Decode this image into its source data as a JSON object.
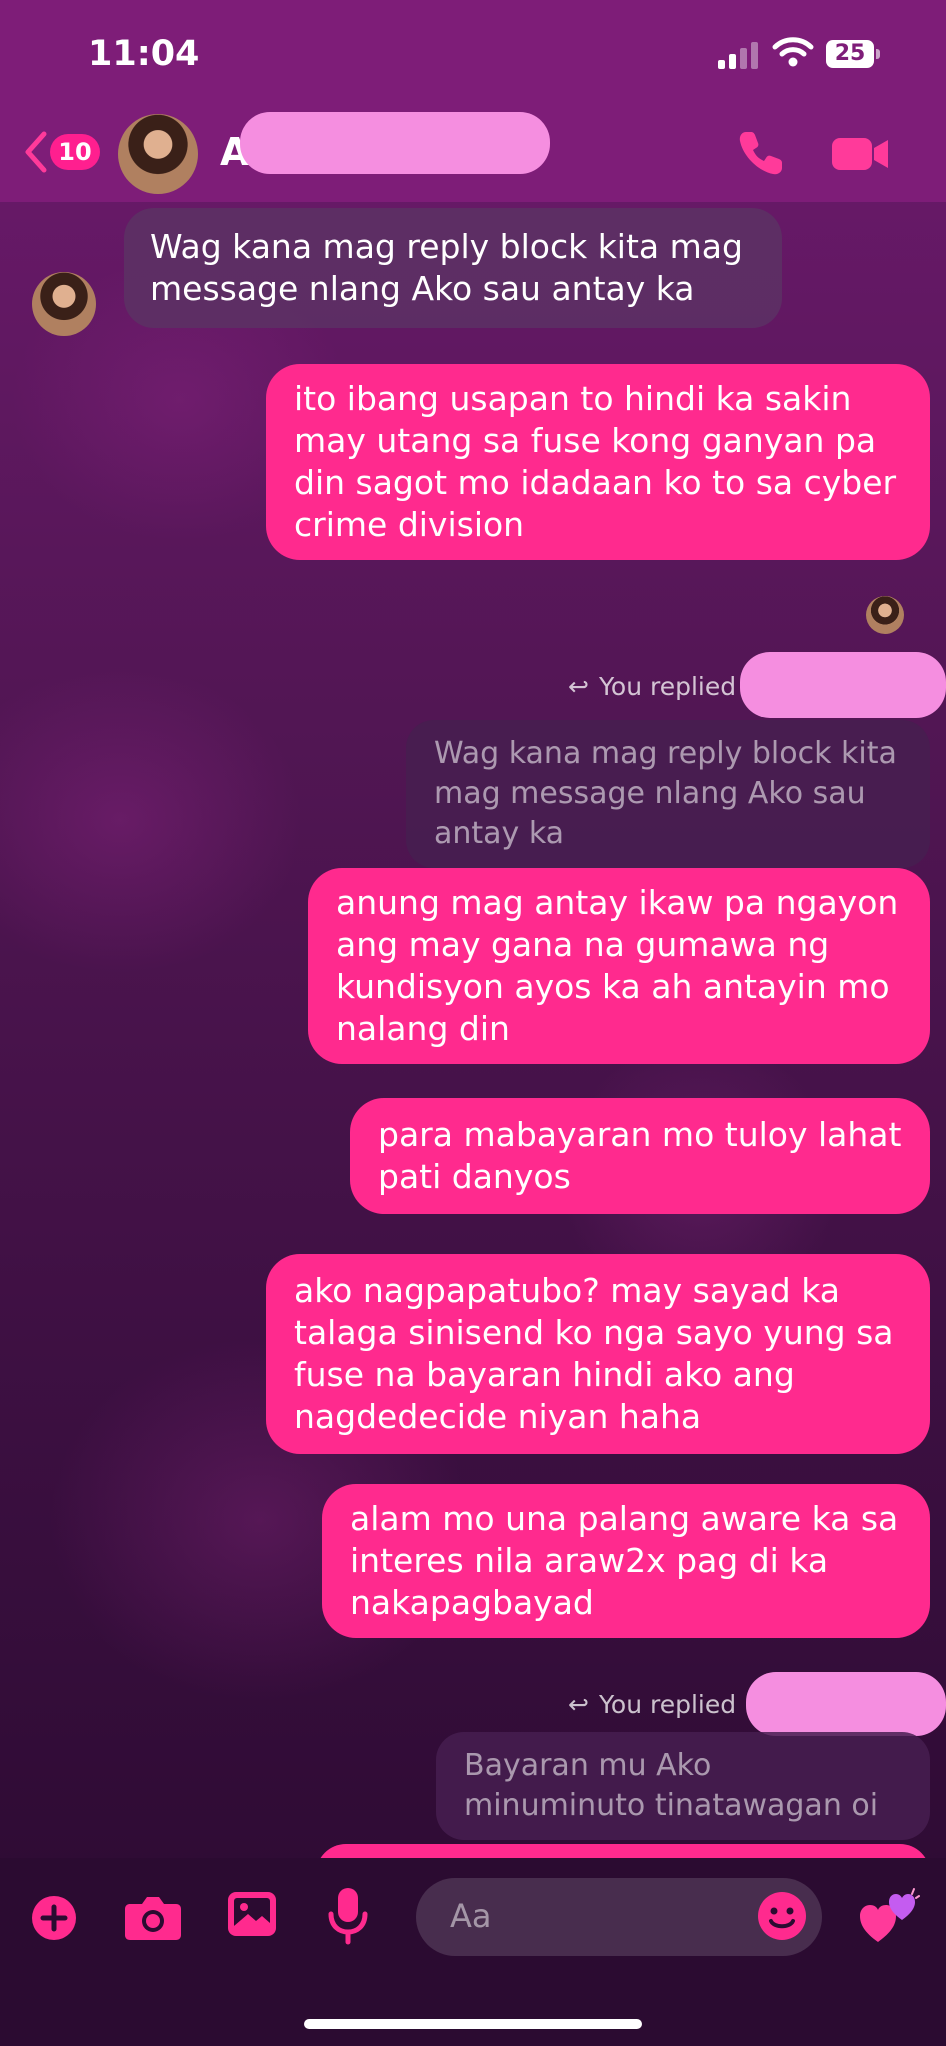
{
  "status_bar": {
    "time": "11:04",
    "battery": "25"
  },
  "header": {
    "back_count": "10",
    "contact_initial": "A"
  },
  "messages": {
    "m1": "Wag kana mag reply block kita mag message nlang Ako sau antay ka",
    "m2": "ito ibang usapan to hindi ka sakin may utang sa fuse kong ganyan pa din sagot mo idadaan ko to sa cyber crime division",
    "reply1_label": "You replied",
    "quote1": "Wag kana mag reply block kita mag message nlang Ako sau antay ka",
    "m3": "anung mag antay ikaw pa ngayon ang may gana na gumawa ng kundisyon ayos ka ah antayin mo nalang din",
    "m4": "para mabayaran mo tuloy lahat pati danyos",
    "m5": "ako nagpapatubo? may sayad ka talaga sinisend ko nga sayo yung sa fuse na bayaran hindi ako ang nagdedecide niyan haha",
    "m6": "alam mo una palang aware ka sa interes nila araw2x pag di ka nakapagbayad",
    "reply2_label": "You replied",
    "quote2": "Bayaran mu Ako minuminuto tinatawagan oi"
  },
  "composer": {
    "placeholder": "Aa"
  },
  "colors": {
    "accent": "#ff2a8e",
    "header": "#7e1d78",
    "incoming": "#5c3064"
  },
  "icons": [
    "back-chevron-icon",
    "phone-icon",
    "video-camera-icon",
    "plus-icon",
    "camera-icon",
    "photo-icon",
    "microphone-icon",
    "emoji-icon",
    "hearts-icon",
    "reply-arrow-icon",
    "wifi-icon",
    "signal-icon",
    "battery-icon"
  ]
}
